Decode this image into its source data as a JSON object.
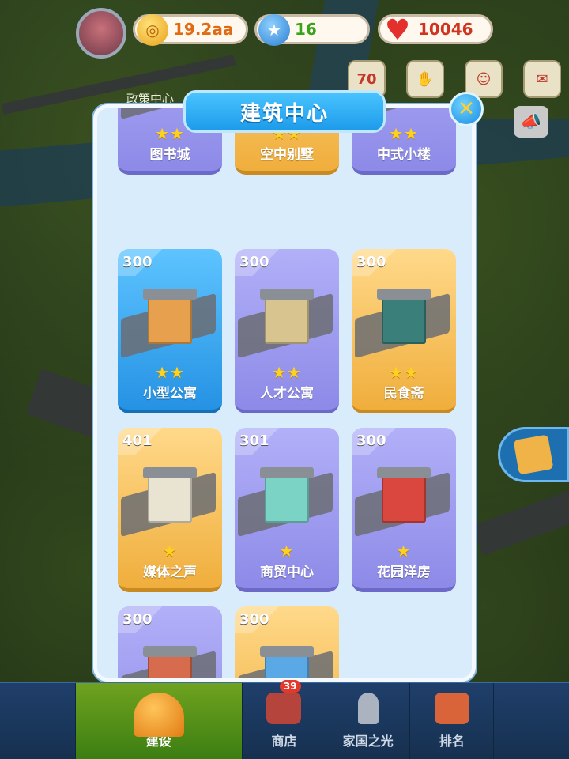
{
  "hud": {
    "gold": "19.2aa",
    "stars": "16",
    "hearts": "10046",
    "policy_label": "政策中心",
    "event_icon_text": "70"
  },
  "panel": {
    "title": "建筑中心",
    "close_icon": "close-icon"
  },
  "cards": [
    {
      "name": "图书城",
      "stars": "★★",
      "number": "",
      "color": "purple"
    },
    {
      "name": "空中别墅",
      "stars": "★★",
      "number": "",
      "color": "gold"
    },
    {
      "name": "中式小楼",
      "stars": "★★",
      "number": "",
      "color": "purple"
    },
    {
      "name": "小型公寓",
      "stars": "★★",
      "number": "300",
      "color": "blue"
    },
    {
      "name": "人才公寓",
      "stars": "★★",
      "number": "300",
      "color": "purple"
    },
    {
      "name": "民食斋",
      "stars": "★★",
      "number": "300",
      "color": "gold"
    },
    {
      "name": "媒体之声",
      "stars": "★",
      "number": "401",
      "color": "gold"
    },
    {
      "name": "商贸中心",
      "stars": "★",
      "number": "301",
      "color": "purple"
    },
    {
      "name": "花园洋房",
      "stars": "★",
      "number": "300",
      "color": "purple"
    },
    {
      "name": "",
      "stars": "",
      "number": "300",
      "color": "purple"
    },
    {
      "name": "",
      "stars": "",
      "number": "300",
      "color": "gold"
    }
  ],
  "nav": {
    "build": "建设",
    "shop": "商店",
    "shop_badge": "39",
    "home_light": "家国之光",
    "rank": "排名"
  }
}
